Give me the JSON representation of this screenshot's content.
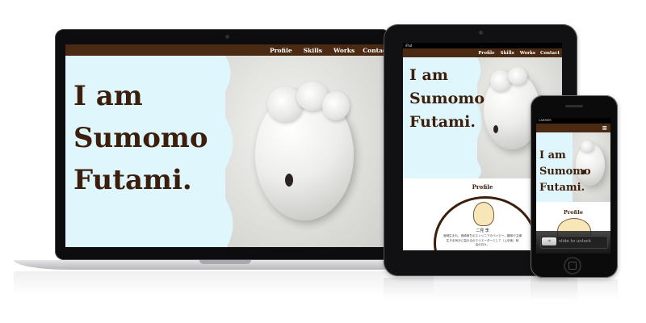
{
  "nav": {
    "items": [
      "Profile",
      "Skills",
      "Works",
      "Contact"
    ]
  },
  "hero": {
    "line1": "I am",
    "line2": "Sumomo",
    "line3": "Futami."
  },
  "tablet": {
    "status_left": "iPad",
    "section_title": "Profile",
    "profile_name": "二見 李",
    "profile_text_1": "宮崎生まれ、宮崎育ちのエンジニアのベイビー。趣味や主婦",
    "profile_text_2": "生きる気分に溢れるのクリエーターとして（上京後）就",
    "profile_text_3": "活の日々。"
  },
  "phone": {
    "status_carrier": "CARRIER",
    "section_title": "Profile",
    "unlock_text": "slide to unlock"
  },
  "colors": {
    "brand_brown": "#4a2a12",
    "hero_text": "#3b1f0c",
    "hero_bg": "#dff7fc"
  }
}
